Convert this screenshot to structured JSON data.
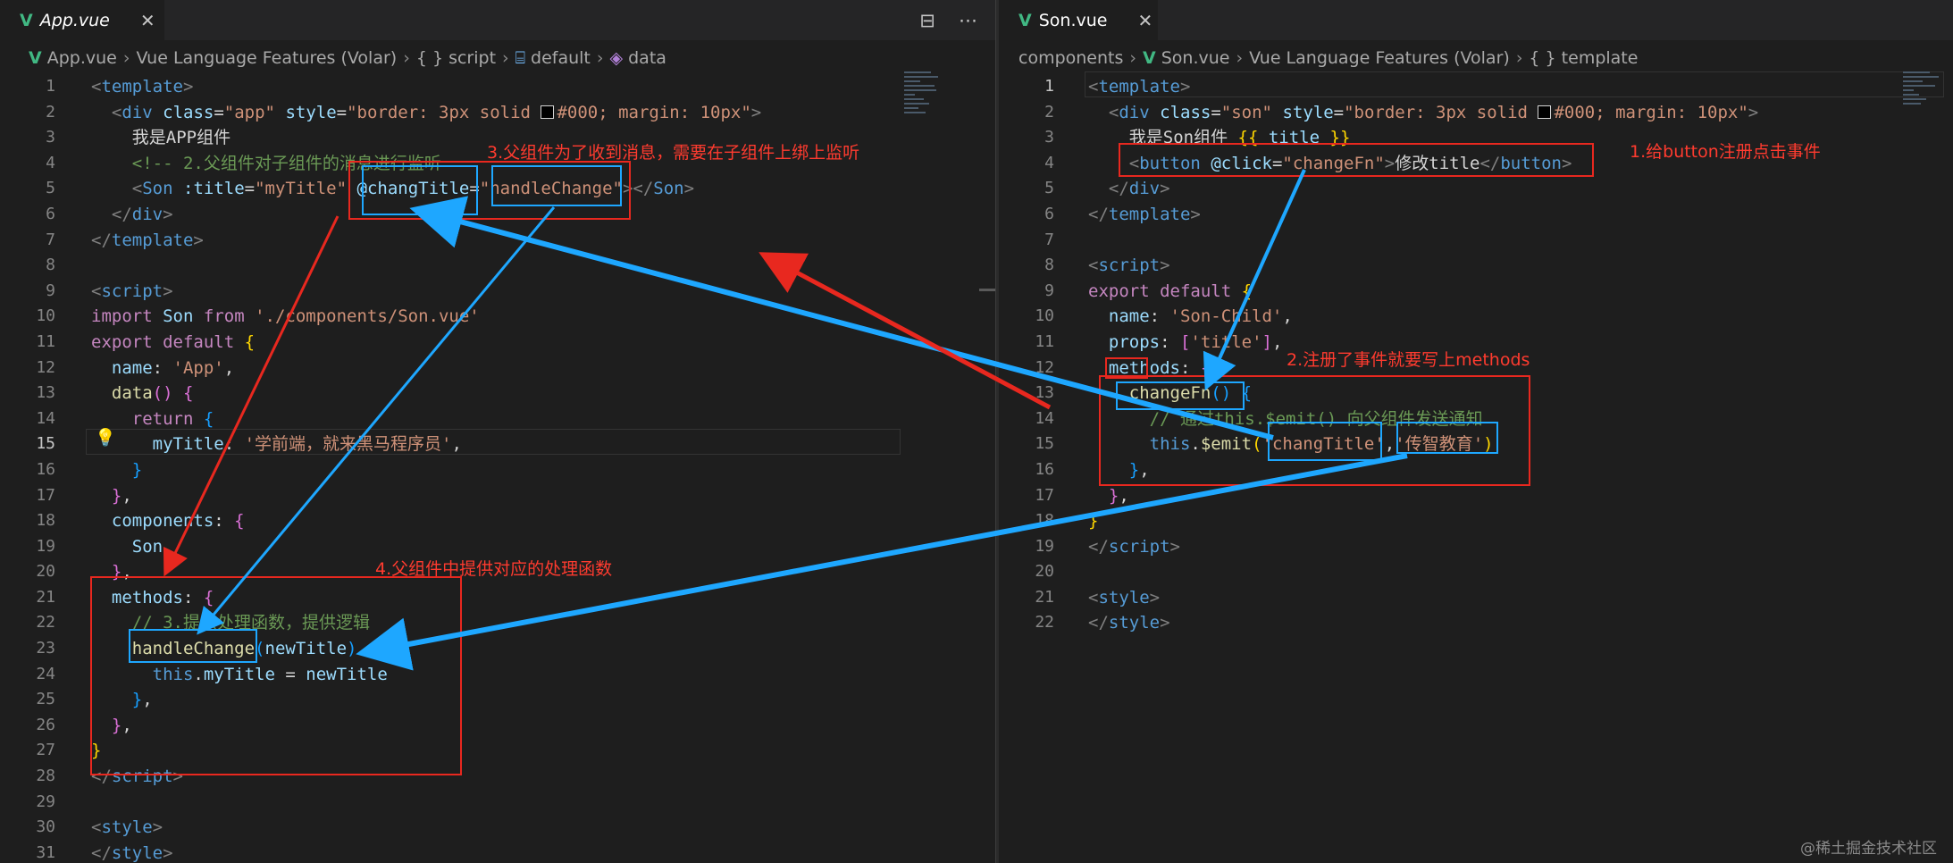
{
  "left": {
    "tab": {
      "label": "App.vue",
      "close": "✕"
    },
    "actions": {
      "split": "⊟",
      "more": "⋯"
    },
    "breadcrumb": [
      "App.vue",
      "Vue Language Features (Volar)",
      "{ } script",
      "default",
      "data"
    ],
    "lines": [
      {
        "n": "1",
        "segs": [
          [
            "c-tag",
            "<"
          ],
          [
            "c-el",
            "template"
          ],
          [
            "c-tag",
            ">"
          ]
        ]
      },
      {
        "n": "2",
        "segs": [
          [
            "c-txt",
            "  "
          ],
          [
            "c-tag",
            "<"
          ],
          [
            "c-el",
            "div"
          ],
          [
            "c-txt",
            " "
          ],
          [
            "c-attr",
            "class"
          ],
          [
            "c-txt",
            "="
          ],
          [
            "c-str",
            "\"app\""
          ],
          [
            "c-txt",
            " "
          ],
          [
            "c-attr",
            "style"
          ],
          [
            "c-txt",
            "="
          ],
          [
            "c-str",
            "\"border: 3px solid "
          ],
          [
            "swatch",
            ""
          ],
          [
            "c-str",
            "#000; margin: 10px\""
          ],
          [
            "c-tag",
            ">"
          ]
        ]
      },
      {
        "n": "3",
        "segs": [
          [
            "c-txt",
            "    我是APP组件"
          ]
        ]
      },
      {
        "n": "4",
        "segs": [
          [
            "c-txt",
            "    "
          ],
          [
            "c-cmt",
            "<!-- 2.父组件对子组件的消息进行监听"
          ]
        ]
      },
      {
        "n": "5",
        "segs": [
          [
            "c-txt",
            "    "
          ],
          [
            "c-tag",
            "<"
          ],
          [
            "c-el",
            "Son"
          ],
          [
            "c-txt",
            " "
          ],
          [
            "c-attr",
            ":title"
          ],
          [
            "c-txt",
            "="
          ],
          [
            "c-str",
            "\"myTitle\""
          ],
          [
            "c-txt",
            " "
          ],
          [
            "c-attr",
            "@changTitle"
          ],
          [
            "c-txt",
            "="
          ],
          [
            "c-str",
            "\"handleChange\""
          ],
          [
            "c-tag",
            "></"
          ],
          [
            "c-el",
            "Son"
          ],
          [
            "c-tag",
            ">"
          ]
        ]
      },
      {
        "n": "6",
        "segs": [
          [
            "c-txt",
            "  "
          ],
          [
            "c-tag",
            "</"
          ],
          [
            "c-el",
            "div"
          ],
          [
            "c-tag",
            ">"
          ]
        ]
      },
      {
        "n": "7",
        "segs": [
          [
            "c-tag",
            "</"
          ],
          [
            "c-el",
            "template"
          ],
          [
            "c-tag",
            ">"
          ]
        ]
      },
      {
        "n": "8",
        "segs": []
      },
      {
        "n": "9",
        "segs": [
          [
            "c-tag",
            "<"
          ],
          [
            "c-el",
            "script"
          ],
          [
            "c-tag",
            ">"
          ]
        ]
      },
      {
        "n": "10",
        "segs": [
          [
            "c-kw",
            "import"
          ],
          [
            "c-txt",
            " "
          ],
          [
            "c-prop",
            "Son"
          ],
          [
            "c-txt",
            " "
          ],
          [
            "c-kw",
            "from"
          ],
          [
            "c-txt",
            " "
          ],
          [
            "c-str",
            "'./components/Son.vue'"
          ]
        ]
      },
      {
        "n": "11",
        "segs": [
          [
            "c-kw",
            "export"
          ],
          [
            "c-txt",
            " "
          ],
          [
            "c-kw",
            "default"
          ],
          [
            "c-txt",
            " "
          ],
          [
            "c-br",
            "{"
          ]
        ]
      },
      {
        "n": "12",
        "segs": [
          [
            "c-txt",
            "  "
          ],
          [
            "c-prop",
            "name"
          ],
          [
            "c-txt",
            ": "
          ],
          [
            "c-str",
            "'App'"
          ],
          [
            "c-txt",
            ","
          ]
        ]
      },
      {
        "n": "13",
        "segs": [
          [
            "c-txt",
            "  "
          ],
          [
            "c-fn",
            "data"
          ],
          [
            "c-br2",
            "()"
          ],
          [
            "c-txt",
            " "
          ],
          [
            "c-br2",
            "{"
          ]
        ]
      },
      {
        "n": "14",
        "segs": [
          [
            "c-txt",
            "    "
          ],
          [
            "c-kw",
            "return"
          ],
          [
            "c-txt",
            " "
          ],
          [
            "c-br3",
            "{"
          ]
        ]
      },
      {
        "n": "15",
        "cur": true,
        "segs": [
          [
            "c-txt",
            "      "
          ],
          [
            "c-prop",
            "myTitle"
          ],
          [
            "c-txt",
            ": "
          ],
          [
            "c-str",
            "'学前端，就来黑马程序员'"
          ],
          [
            "c-txt",
            ","
          ]
        ]
      },
      {
        "n": "16",
        "segs": [
          [
            "c-txt",
            "    "
          ],
          [
            "c-br3",
            "}"
          ]
        ]
      },
      {
        "n": "17",
        "segs": [
          [
            "c-txt",
            "  "
          ],
          [
            "c-br2",
            "}"
          ],
          [
            "c-txt",
            ","
          ]
        ]
      },
      {
        "n": "18",
        "segs": [
          [
            "c-txt",
            "  "
          ],
          [
            "c-prop",
            "components"
          ],
          [
            "c-txt",
            ": "
          ],
          [
            "c-br2",
            "{"
          ]
        ]
      },
      {
        "n": "19",
        "segs": [
          [
            "c-txt",
            "    "
          ],
          [
            "c-prop",
            "Son"
          ],
          [
            "c-txt",
            ","
          ]
        ]
      },
      {
        "n": "20",
        "segs": [
          [
            "c-txt",
            "  "
          ],
          [
            "c-br2",
            "}"
          ],
          [
            "c-txt",
            ","
          ]
        ]
      },
      {
        "n": "21",
        "segs": [
          [
            "c-txt",
            "  "
          ],
          [
            "c-prop",
            "methods"
          ],
          [
            "c-txt",
            ": "
          ],
          [
            "c-br2",
            "{"
          ]
        ]
      },
      {
        "n": "22",
        "segs": [
          [
            "c-txt",
            "    "
          ],
          [
            "c-cmt",
            "// 3.提供处理函数，提供逻辑"
          ]
        ]
      },
      {
        "n": "23",
        "segs": [
          [
            "c-txt",
            "    "
          ],
          [
            "c-fn",
            "handleChange"
          ],
          [
            "c-br3",
            "("
          ],
          [
            "c-prop",
            "newTitle"
          ],
          [
            "c-br3",
            ")"
          ],
          [
            "c-txt",
            " "
          ],
          [
            "c-br3",
            "{"
          ]
        ]
      },
      {
        "n": "24",
        "segs": [
          [
            "c-txt",
            "      "
          ],
          [
            "c-kw2",
            "this"
          ],
          [
            "c-txt",
            "."
          ],
          [
            "c-prop",
            "myTitle"
          ],
          [
            "c-txt",
            " = "
          ],
          [
            "c-prop",
            "newTitle"
          ]
        ]
      },
      {
        "n": "25",
        "segs": [
          [
            "c-txt",
            "    "
          ],
          [
            "c-br3",
            "}"
          ],
          [
            "c-txt",
            ","
          ]
        ]
      },
      {
        "n": "26",
        "segs": [
          [
            "c-txt",
            "  "
          ],
          [
            "c-br2",
            "}"
          ],
          [
            "c-txt",
            ","
          ]
        ]
      },
      {
        "n": "27",
        "segs": [
          [
            "c-br",
            "}"
          ]
        ]
      },
      {
        "n": "28",
        "segs": [
          [
            "c-tag",
            "</"
          ],
          [
            "c-el",
            "script"
          ],
          [
            "c-tag",
            ">"
          ]
        ]
      },
      {
        "n": "29",
        "segs": []
      },
      {
        "n": "30",
        "segs": [
          [
            "c-tag",
            "<"
          ],
          [
            "c-el",
            "style"
          ],
          [
            "c-tag",
            ">"
          ]
        ]
      },
      {
        "n": "31",
        "segs": [
          [
            "c-tag",
            "</"
          ],
          [
            "c-el",
            "style"
          ],
          [
            "c-tag",
            ">"
          ]
        ]
      }
    ]
  },
  "right": {
    "tab": {
      "label": "Son.vue",
      "close": "✕"
    },
    "breadcrumb": [
      "components",
      "Son.vue",
      "Vue Language Features (Volar)",
      "{ } template"
    ],
    "lines": [
      {
        "n": "1",
        "cur": true,
        "segs": [
          [
            "c-tag",
            "<"
          ],
          [
            "c-el",
            "template"
          ],
          [
            "c-tag",
            ">"
          ]
        ]
      },
      {
        "n": "2",
        "segs": [
          [
            "c-txt",
            "  "
          ],
          [
            "c-tag",
            "<"
          ],
          [
            "c-el",
            "div"
          ],
          [
            "c-txt",
            " "
          ],
          [
            "c-attr",
            "class"
          ],
          [
            "c-txt",
            "="
          ],
          [
            "c-str",
            "\"son\""
          ],
          [
            "c-txt",
            " "
          ],
          [
            "c-attr",
            "style"
          ],
          [
            "c-txt",
            "="
          ],
          [
            "c-str",
            "\"border: 3px solid "
          ],
          [
            "swatch",
            ""
          ],
          [
            "c-str",
            "#000; margin: 10px\""
          ],
          [
            "c-tag",
            ">"
          ]
        ]
      },
      {
        "n": "3",
        "segs": [
          [
            "c-txt",
            "    我是Son组件 "
          ],
          [
            "c-br",
            "{{"
          ],
          [
            "c-txt",
            " "
          ],
          [
            "c-prop",
            "title"
          ],
          [
            "c-txt",
            " "
          ],
          [
            "c-br",
            "}}"
          ]
        ]
      },
      {
        "n": "4",
        "segs": [
          [
            "c-txt",
            "    "
          ],
          [
            "c-tag",
            "<"
          ],
          [
            "c-el",
            "button"
          ],
          [
            "c-txt",
            " "
          ],
          [
            "c-attr",
            "@click"
          ],
          [
            "c-txt",
            "="
          ],
          [
            "c-str",
            "\"changeFn\""
          ],
          [
            "c-tag",
            ">"
          ],
          [
            "c-txt",
            "修改title"
          ],
          [
            "c-tag",
            "</"
          ],
          [
            "c-el",
            "button"
          ],
          [
            "c-tag",
            ">"
          ]
        ]
      },
      {
        "n": "5",
        "segs": [
          [
            "c-txt",
            "  "
          ],
          [
            "c-tag",
            "</"
          ],
          [
            "c-el",
            "div"
          ],
          [
            "c-tag",
            ">"
          ]
        ]
      },
      {
        "n": "6",
        "segs": [
          [
            "c-tag",
            "</"
          ],
          [
            "c-el",
            "template"
          ],
          [
            "c-tag",
            ">"
          ]
        ]
      },
      {
        "n": "7",
        "segs": []
      },
      {
        "n": "8",
        "segs": [
          [
            "c-tag",
            "<"
          ],
          [
            "c-el",
            "script"
          ],
          [
            "c-tag",
            ">"
          ]
        ]
      },
      {
        "n": "9",
        "segs": [
          [
            "c-kw",
            "export"
          ],
          [
            "c-txt",
            " "
          ],
          [
            "c-kw",
            "default"
          ],
          [
            "c-txt",
            " "
          ],
          [
            "c-br",
            "{"
          ]
        ]
      },
      {
        "n": "10",
        "segs": [
          [
            "c-txt",
            "  "
          ],
          [
            "c-prop",
            "name"
          ],
          [
            "c-txt",
            ": "
          ],
          [
            "c-str",
            "'Son-Child'"
          ],
          [
            "c-txt",
            ","
          ]
        ]
      },
      {
        "n": "11",
        "segs": [
          [
            "c-txt",
            "  "
          ],
          [
            "c-prop",
            "props"
          ],
          [
            "c-txt",
            ": "
          ],
          [
            "c-br2",
            "["
          ],
          [
            "c-str",
            "'title'"
          ],
          [
            "c-br2",
            "]"
          ],
          [
            "c-txt",
            ","
          ]
        ]
      },
      {
        "n": "12",
        "segs": [
          [
            "c-txt",
            "  "
          ],
          [
            "c-prop",
            "methods"
          ],
          [
            "c-txt",
            ": "
          ],
          [
            "c-br2",
            "{"
          ]
        ]
      },
      {
        "n": "13",
        "segs": [
          [
            "c-txt",
            "    "
          ],
          [
            "c-fn",
            "changeFn"
          ],
          [
            "c-br3",
            "()"
          ],
          [
            "c-txt",
            " "
          ],
          [
            "c-br3",
            "{"
          ]
        ]
      },
      {
        "n": "14",
        "segs": [
          [
            "c-txt",
            "      "
          ],
          [
            "c-cmt",
            "// 通过this.$emit() 向父组件发送通知"
          ]
        ]
      },
      {
        "n": "15",
        "segs": [
          [
            "c-txt",
            "      "
          ],
          [
            "c-kw2",
            "this"
          ],
          [
            "c-txt",
            "."
          ],
          [
            "c-fn",
            "$emit"
          ],
          [
            "c-br",
            "("
          ],
          [
            "c-str",
            "'changTitle'"
          ],
          [
            "c-txt",
            ","
          ],
          [
            "c-str",
            "'传智教育'"
          ],
          [
            "c-br",
            ")"
          ]
        ]
      },
      {
        "n": "16",
        "segs": [
          [
            "c-txt",
            "    "
          ],
          [
            "c-br3",
            "}"
          ],
          [
            "c-txt",
            ","
          ]
        ]
      },
      {
        "n": "17",
        "segs": [
          [
            "c-txt",
            "  "
          ],
          [
            "c-br2",
            "}"
          ],
          [
            "c-txt",
            ","
          ]
        ]
      },
      {
        "n": "18",
        "segs": [
          [
            "c-br",
            "}"
          ]
        ]
      },
      {
        "n": "19",
        "segs": [
          [
            "c-tag",
            "</"
          ],
          [
            "c-el",
            "script"
          ],
          [
            "c-tag",
            ">"
          ]
        ]
      },
      {
        "n": "20",
        "segs": []
      },
      {
        "n": "21",
        "segs": [
          [
            "c-tag",
            "<"
          ],
          [
            "c-el",
            "style"
          ],
          [
            "c-tag",
            ">"
          ]
        ]
      },
      {
        "n": "22",
        "segs": [
          [
            "c-tag",
            "</"
          ],
          [
            "c-el",
            "style"
          ],
          [
            "c-tag",
            ">"
          ]
        ]
      }
    ]
  },
  "annotations": {
    "step1": "1.给button注册点击事件",
    "step2": "2.注册了事件就要写上methods",
    "step3": "3.父组件为了收到消息，需要在子组件上绑上监听",
    "step4": "4.父组件中提供对应的处理函数"
  },
  "watermark": "@稀土掘金技术社区",
  "colors": {
    "annotation_red": "#e8281f",
    "annotation_blue": "#1ea7ff",
    "vue_green": "#41b883"
  }
}
